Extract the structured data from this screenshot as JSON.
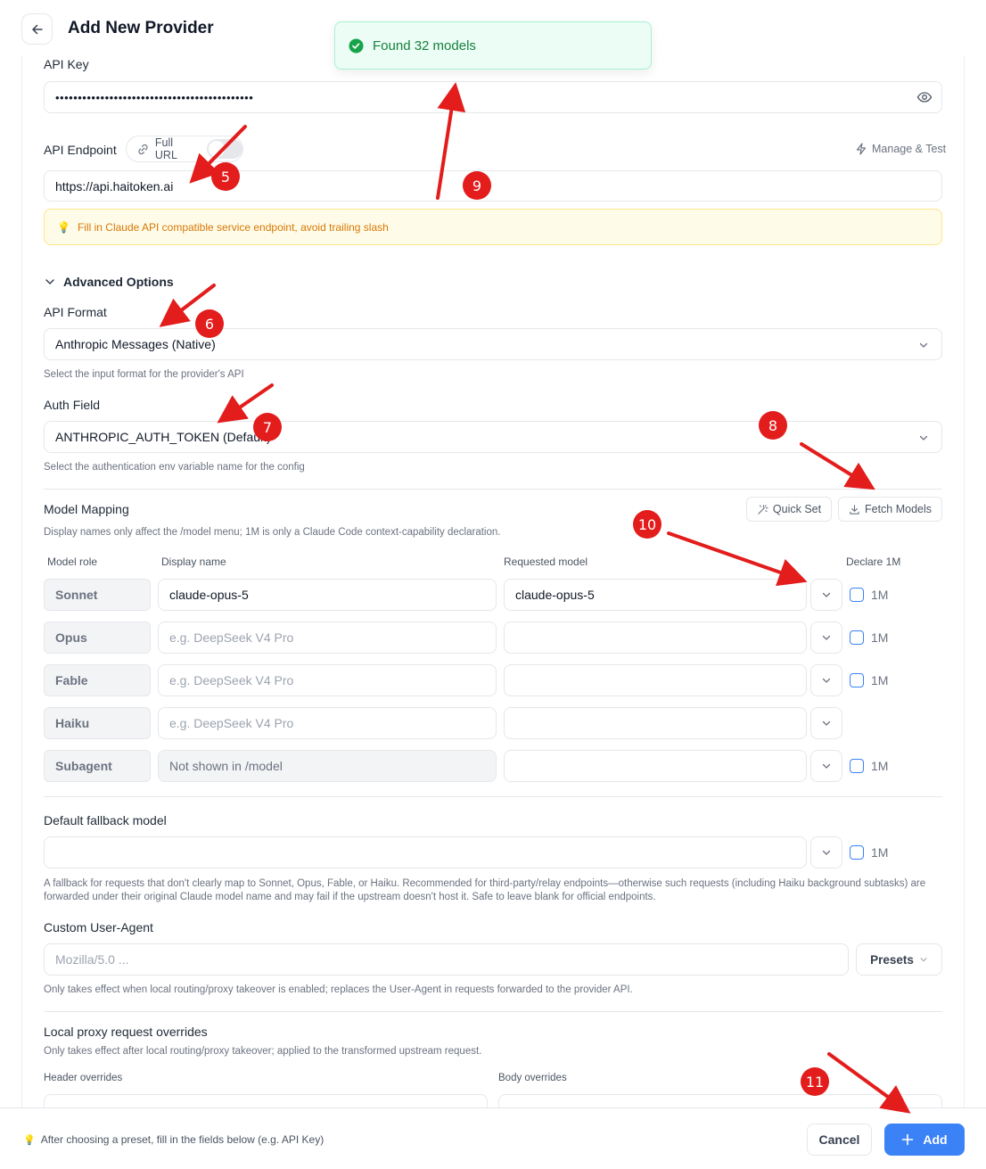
{
  "header": {
    "title": "Add New Provider"
  },
  "toast": {
    "message": "Found 32 models"
  },
  "api_key": {
    "label": "API Key",
    "value": "••••••••••••••••••••••••••••••••••••••••••••"
  },
  "api_endpoint": {
    "label": "API Endpoint",
    "full_url_label": "Full URL",
    "manage_test_label": "Manage & Test",
    "value": "https://api.haitoken.ai",
    "tip": "Fill in Claude API compatible service endpoint, avoid trailing slash"
  },
  "advanced": {
    "title": "Advanced Options",
    "api_format": {
      "label": "API Format",
      "value": "Anthropic Messages (Native)",
      "hint": "Select the input format for the provider's API"
    },
    "auth_field": {
      "label": "Auth Field",
      "value": "ANTHROPIC_AUTH_TOKEN (Default)",
      "hint": "Select the authentication env variable name for the config"
    }
  },
  "model_mapping": {
    "title": "Model Mapping",
    "description": "Display names only affect the /model menu; 1M is only a Claude Code context-capability declaration.",
    "quick_set_label": "Quick Set",
    "fetch_models_label": "Fetch Models",
    "columns": {
      "role": "Model role",
      "display": "Display name",
      "requested": "Requested model",
      "declare": "Declare 1M"
    },
    "rows": [
      {
        "role": "Sonnet",
        "display": "claude-opus-5",
        "display_placeholder": "",
        "requested": "claude-opus-5",
        "one_m": "1M"
      },
      {
        "role": "Opus",
        "display": "",
        "display_placeholder": "e.g. DeepSeek V4 Pro",
        "requested": "",
        "one_m": "1M"
      },
      {
        "role": "Fable",
        "display": "",
        "display_placeholder": "e.g. DeepSeek V4 Pro",
        "requested": "",
        "one_m": "1M"
      },
      {
        "role": "Haiku",
        "display": "",
        "display_placeholder": "e.g. DeepSeek V4 Pro",
        "requested": "",
        "one_m": ""
      },
      {
        "role": "Subagent",
        "display": "",
        "display_placeholder": "Not shown in /model",
        "requested": "",
        "one_m": "1M"
      }
    ]
  },
  "fallback": {
    "label": "Default fallback model",
    "one_m": "1M",
    "hint": "A fallback for requests that don't clearly map to Sonnet, Opus, Fable, or Haiku. Recommended for third-party/relay endpoints—otherwise such requests (including Haiku background subtasks) are forwarded under their original Claude model name and may fail if the upstream doesn't host it. Safe to leave blank for official endpoints."
  },
  "user_agent": {
    "label": "Custom User-Agent",
    "placeholder": "Mozilla/5.0 ...",
    "presets_label": "Presets",
    "hint": "Only takes effect when local routing/proxy takeover is enabled; replaces the User-Agent in requests forwarded to the provider API."
  },
  "overrides": {
    "title": "Local proxy request overrides",
    "hint": "Only takes effect after local routing/proxy takeover; applied to the transformed upstream request.",
    "header_label": "Header overrides",
    "body_label": "Body overrides"
  },
  "footer": {
    "tip": "After choosing a preset, fill in the fields below (e.g. API Key)",
    "cancel_label": "Cancel",
    "add_label": "Add"
  },
  "annotations": [
    "5",
    "6",
    "7",
    "8",
    "9",
    "10",
    "11"
  ],
  "colors": {
    "accent": "#3b82f6",
    "annotation": "#e31c1c",
    "success": "#15803d",
    "warning_bg": "#fefce8"
  }
}
